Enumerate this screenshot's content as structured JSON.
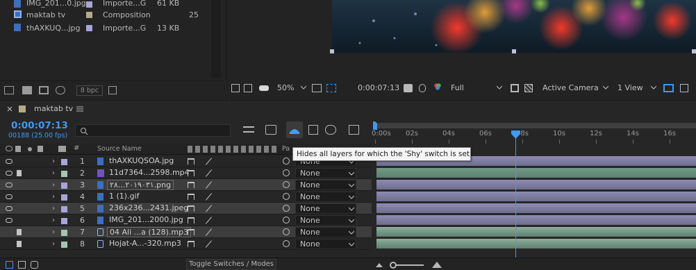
{
  "project": {
    "items": [
      {
        "name": "IMG_201...0.jpg",
        "label_color": "#a9a5d8",
        "type": "Importe...G",
        "size": "61 KB"
      },
      {
        "name": "maktab tv",
        "label_color": "#b5a98a",
        "type": "Composition",
        "size": "25"
      },
      {
        "name": "thAXKUQ...jpg",
        "label_color": "#a9a5d8",
        "type": "Importe...G",
        "size": "13 KB"
      }
    ],
    "bpc": "8 bpc"
  },
  "viewer": {
    "zoom": "50%",
    "timecode": "0:00:07:13",
    "resolution": "Full",
    "camera": "Active Camera",
    "view": "1 View"
  },
  "timeline": {
    "comp_name": "maktab tv",
    "current_time": "0:00:07:13",
    "frame_info": "00188 (25.00 fps)",
    "search_placeholder": "",
    "columns": {
      "hash": "#",
      "source_name": "Source Name",
      "parent": "Pa"
    },
    "tooltip": "Hides all layers for which the 'Shy' switch is set",
    "ruler_ticks": [
      "0:00s",
      "02s",
      "04s",
      "06s",
      "08s",
      "10s",
      "12s",
      "14s",
      "16s"
    ],
    "layers": [
      {
        "num": "1",
        "name": "thAXKUQSOA.jpg",
        "parent": "None",
        "label_color": "#a9a5d8",
        "kind": "image",
        "audio": false
      },
      {
        "num": "2",
        "name": "11d7364...2598.mp4",
        "parent": "None",
        "label_color": "#a6c4b3",
        "kind": "video",
        "audio": true
      },
      {
        "num": "3",
        "name": "٢٠١٩٠٣١...٢٨.png",
        "parent": "None",
        "label_color": "#a9a5d8",
        "kind": "image",
        "audio": false
      },
      {
        "num": "4",
        "name": "1 (1).gif",
        "parent": "None",
        "label_color": "#a9a5d8",
        "kind": "image",
        "audio": false
      },
      {
        "num": "5",
        "name": "236x236...2431.jpeg",
        "parent": "None",
        "label_color": "#a9a5d8",
        "kind": "image",
        "audio": false
      },
      {
        "num": "6",
        "name": "IMG_201...2000.jpg",
        "parent": "None",
        "label_color": "#a9a5d8",
        "kind": "image",
        "audio": false
      },
      {
        "num": "7",
        "name": "04 Ali ...a (128).mp3",
        "parent": "None",
        "label_color": "#a6c4b3",
        "kind": "audio",
        "audio": true
      },
      {
        "num": "8",
        "name": "Hojat-A...-320.mp3",
        "parent": "None",
        "label_color": "#a6c4b3",
        "kind": "audio",
        "audio": true
      }
    ],
    "toggle_label": "Toggle Switches / Modes"
  },
  "colors": {
    "accent": "#3d9af6",
    "image_track": "#8d8cb3",
    "video_track": "#6f9a86",
    "audio_track": "#8eae9c"
  }
}
